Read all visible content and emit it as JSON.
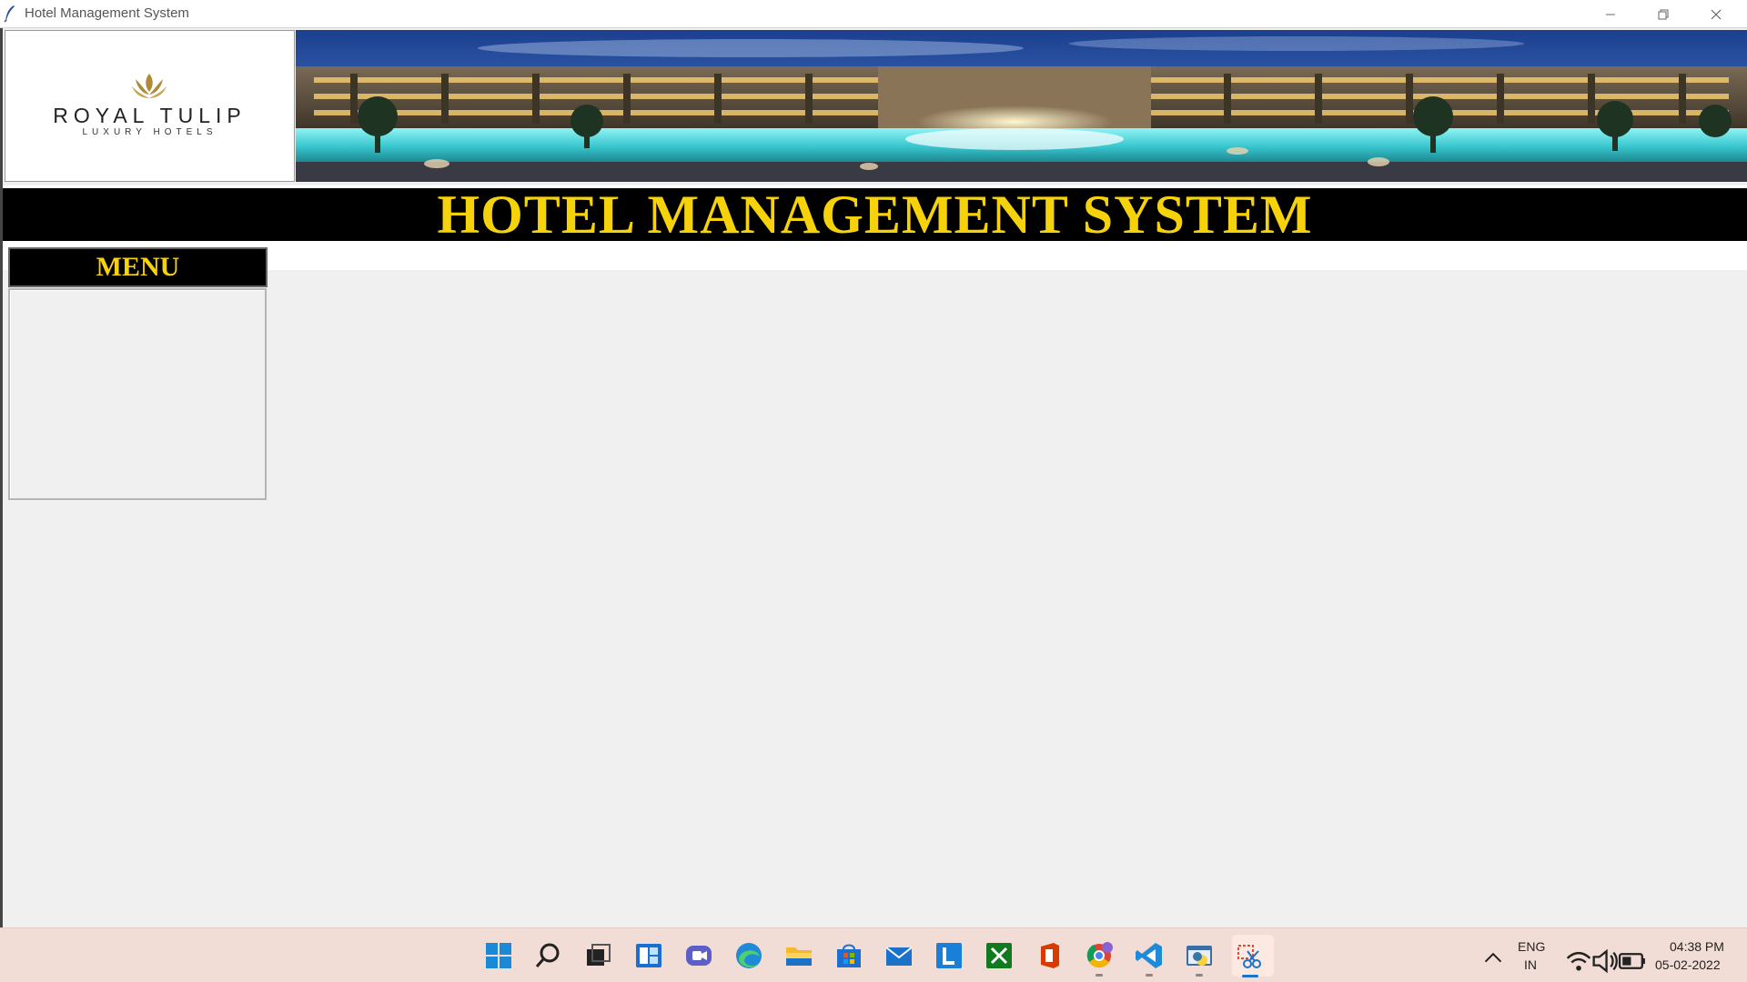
{
  "window": {
    "title": "Hotel Management System",
    "controls": [
      "minimize",
      "restore",
      "close"
    ]
  },
  "logo": {
    "name": "ROYAL TULIP",
    "tagline": "LUXURY HOTELS"
  },
  "header": {
    "title": "HOTEL MANAGEMENT SYSTEM"
  },
  "menu": {
    "title": "MENU",
    "items": []
  },
  "taskbar": {
    "apps": [
      "start-icon",
      "search-icon",
      "task-view-icon",
      "widgets-icon",
      "teams-chat-icon",
      "edge-icon",
      "file-explorer-icon",
      "store-icon",
      "mail-icon",
      "l-app-icon",
      "xbox-icon",
      "office-icon",
      "chrome-icon",
      "vscode-icon",
      "python-idle-icon",
      "snipping-tool-icon"
    ],
    "language": "ENG",
    "region": "IN",
    "time": "04:38 PM",
    "date": "05-02-2022"
  },
  "colors": {
    "title_text": "#f6d20a",
    "band_bg": "#000000",
    "app_bg": "#f0f0f0",
    "taskbar_bg": "#f1ddd5"
  }
}
